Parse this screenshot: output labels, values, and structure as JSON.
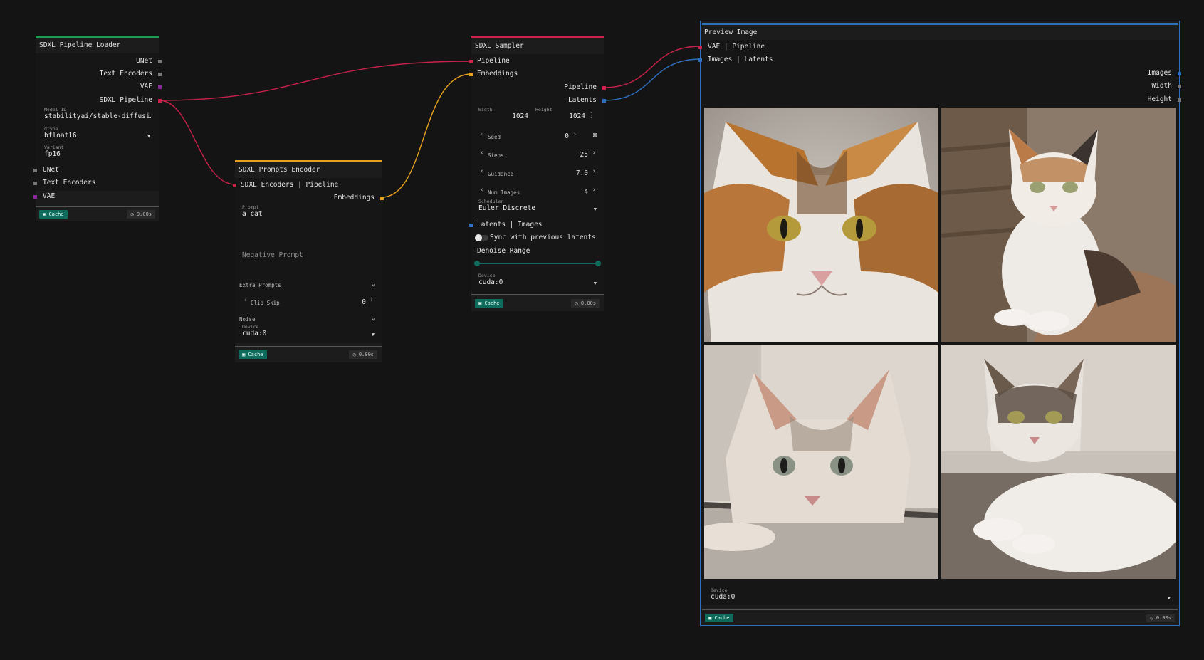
{
  "colors": {
    "pipeline": "#c8214a",
    "embeddings": "#e6a11f",
    "latents": "#2f6fbf",
    "vae": "#8a2a9a",
    "unet_gray": "#777777",
    "cache_badge": "#0f6b5c",
    "loader_accent": "#1f9b4f",
    "encoder_accent": "#e6a11f",
    "sampler_accent": "#c8214a",
    "preview_accent": "#2f6fbf",
    "slider": "#0f6b5c"
  },
  "loader": {
    "title": "SDXL Pipeline Loader",
    "outputs": [
      "UNet",
      "Text Encoders",
      "VAE",
      "SDXL Pipeline"
    ],
    "model_id_label": "Model ID",
    "model_id_value": "stabilityai/stable-diffusi…",
    "dtype_label": "dtype",
    "dtype_value": "bfloat16",
    "variant_label": "Variant",
    "variant_value": "fp16",
    "inputs": [
      "UNet",
      "Text Encoders",
      "VAE"
    ],
    "cache_label": "Cache",
    "time": "0.00s"
  },
  "encoder": {
    "title": "SDXL Prompts Encoder",
    "input": "SDXL Encoders | Pipeline",
    "output": "Embeddings",
    "prompt_label": "Prompt",
    "prompt_value": "a cat",
    "negative_placeholder": "Negative Prompt",
    "extra_prompts": "Extra Prompts",
    "clip_skip_label": "Clip Skip",
    "clip_skip_value": "0",
    "noise_label": "Noise",
    "device_label": "Device",
    "device_value": "cuda:0",
    "cache_label": "Cache",
    "time": "0.00s"
  },
  "sampler": {
    "title": "SDXL Sampler",
    "inputs": [
      "Pipeline",
      "Embeddings"
    ],
    "outputs": [
      "Pipeline",
      "Latents"
    ],
    "width_label": "Width",
    "width_value": "1024",
    "height_label": "Height",
    "height_value": "1024",
    "seed_label": "Seed",
    "seed_value": "0",
    "steps_label": "Steps",
    "steps_value": "25",
    "guidance_label": "Guidance",
    "guidance_value": "7.0",
    "num_images_label": "Num Images",
    "num_images_value": "4",
    "scheduler_label": "Scheduler",
    "scheduler_value": "Euler Discrete",
    "latents_input": "Latents | Images",
    "sync_label": "Sync with previous latents",
    "sync_on": false,
    "denoise_label": "Denoise Range",
    "denoise_range": [
      0,
      1
    ],
    "device_label": "Device",
    "device_value": "cuda:0",
    "cache_label": "Cache",
    "time": "0.00s"
  },
  "preview": {
    "title": "Preview Image",
    "inputs": [
      "VAE | Pipeline",
      "Images | Latents"
    ],
    "outputs": [
      "Images",
      "Width",
      "Height"
    ],
    "images": [
      "cat-photo-1",
      "cat-photo-2",
      "cat-photo-3",
      "cat-photo-4"
    ],
    "device_label": "Device",
    "device_value": "cuda:0",
    "cache_label": "Cache",
    "time": "0.00s"
  },
  "icons": {
    "cache": "trash-icon",
    "time": "clock-icon",
    "more": "kebab-icon",
    "random": "dice-icon"
  }
}
